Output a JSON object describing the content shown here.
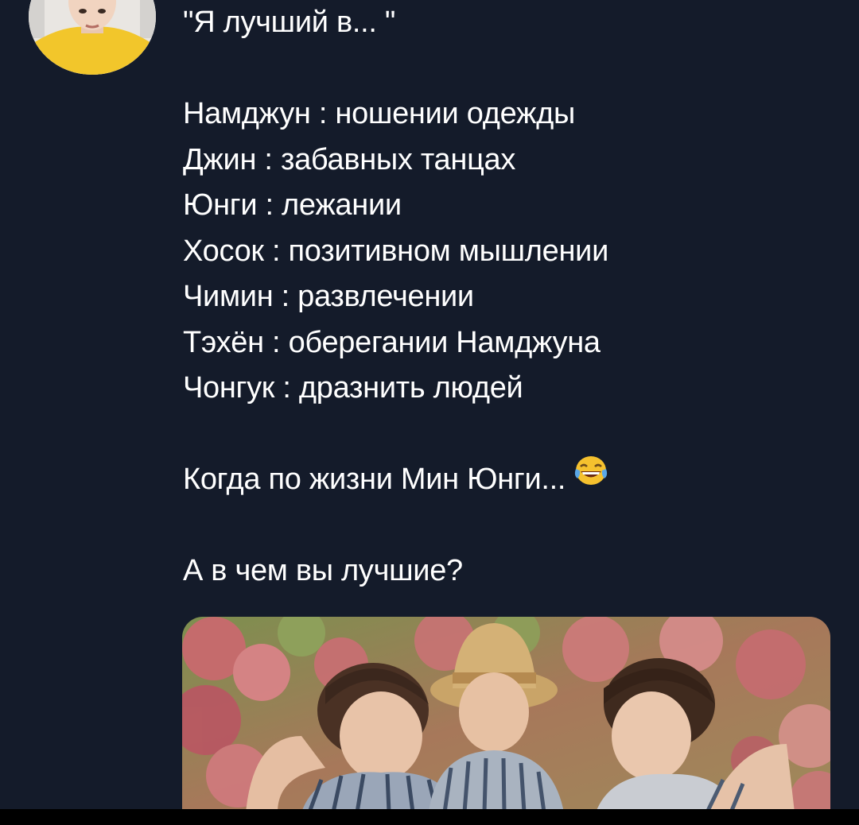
{
  "tweet": {
    "title_line": "\"Я лучший в... \"",
    "list": [
      "Намджун : ношении одежды",
      "Джин : забавных танцах",
      "Юнги : лежании",
      "Хосок : позитивном мышлении",
      "Чимин : развлечении",
      "Тэхён : оберегании Намджуна",
      "Чонгук : дразнить людей"
    ],
    "comment": "Когда по жизни Мин Юнги...",
    "comment_emoji": "face-with-tears-of-joy",
    "question": "А в чем вы лучшие?"
  },
  "colors": {
    "background": "#141b2a",
    "text": "#ffffff",
    "bottom_bar": "#000000"
  }
}
